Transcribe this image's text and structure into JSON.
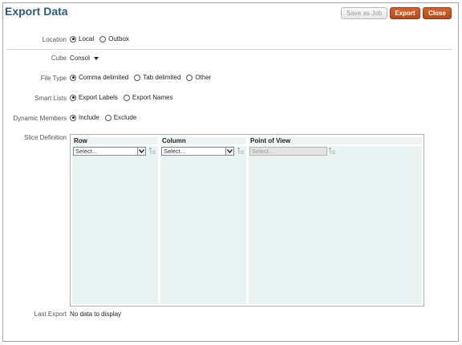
{
  "header": {
    "title": "Export Data"
  },
  "toolbar": {
    "save_as_job_label": "Save as Job",
    "export_label": "Export",
    "close_label": "Close"
  },
  "location": {
    "label": "Location",
    "options": [
      "Local",
      "Outbox"
    ],
    "selected": "Local"
  },
  "cube": {
    "label": "Cube",
    "value": "Consol"
  },
  "file_type": {
    "label": "File Type",
    "options": [
      "Comma delimited",
      "Tab delimited",
      "Other"
    ],
    "selected": "Comma delimited"
  },
  "smart_lists": {
    "label": "Smart Lists",
    "options": [
      "Export Labels",
      "Export Names"
    ],
    "selected": "Export Labels"
  },
  "dynamic_members": {
    "label": "Dynamic Members",
    "options": [
      "Include",
      "Exclude"
    ],
    "selected": "Include"
  },
  "slice_definition": {
    "label": "Slice Definition",
    "columns": [
      {
        "header": "Row",
        "select_value": "Select...",
        "enabled": true
      },
      {
        "header": "Column",
        "select_value": "Select...",
        "enabled": true
      },
      {
        "header": "Point of View",
        "select_value": "Select...",
        "enabled": false
      }
    ]
  },
  "last_export": {
    "label": "Last Export",
    "value": "No data to display"
  },
  "colors": {
    "title": "#2f5a7a",
    "primary_button": "#c4561f",
    "panel": "#e9f3f1"
  }
}
